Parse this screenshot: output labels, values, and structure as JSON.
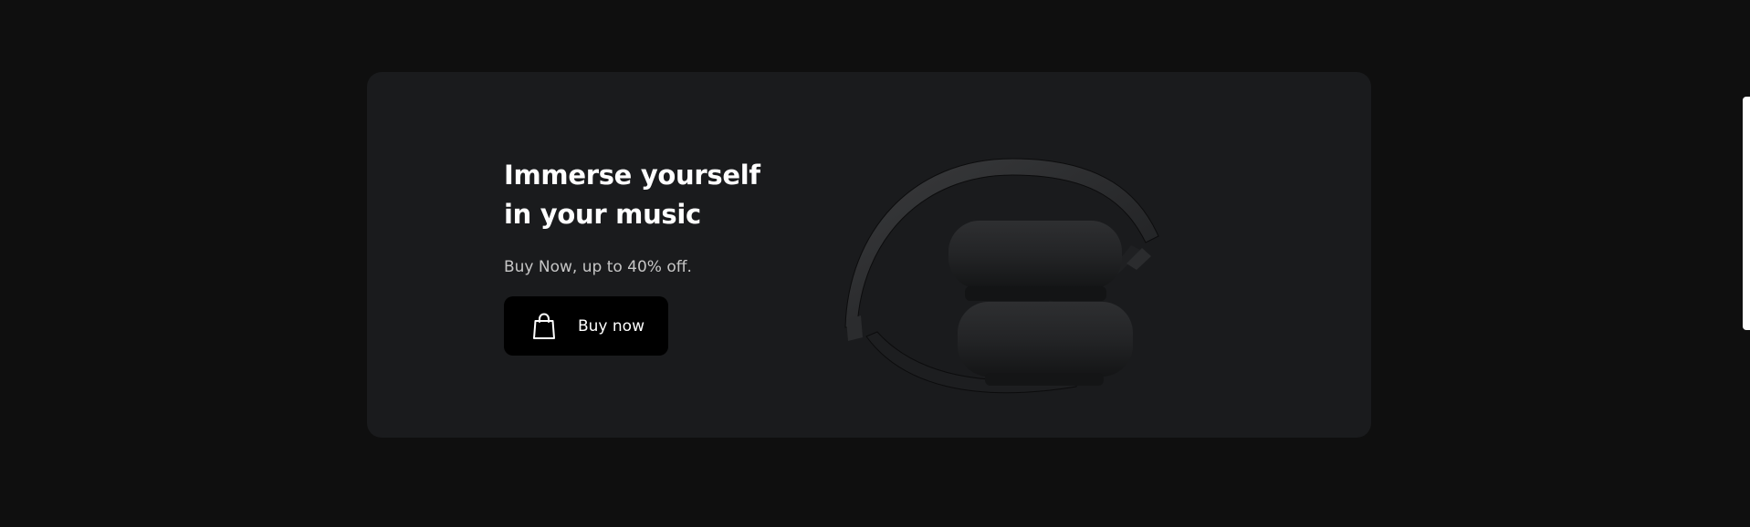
{
  "promo": {
    "title": "Immerse yourself in your music",
    "subtitle": "Buy Now, up to 40% off.",
    "button_label": "Buy now",
    "button_icon": "shopping-bag-icon",
    "image": "headphones-image"
  },
  "colors": {
    "page_background": "#0f0f0f",
    "card_background": "#1a1b1d",
    "button_background": "#000000",
    "title_text": "#ffffff",
    "subtitle_text": "#c6c6c6"
  }
}
